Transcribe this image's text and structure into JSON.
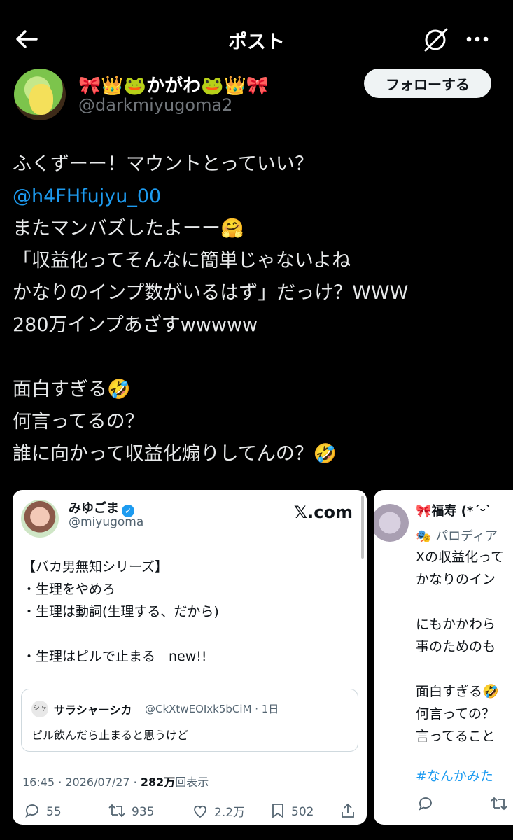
{
  "header": {
    "title": "ポスト"
  },
  "author": {
    "display_name": "🎀👑🐸かがわ🐸👑🎀",
    "handle": "@darkmiyugoma2",
    "follow_label": "フォローする"
  },
  "post": {
    "lines": [
      "ふくずーー！マウントとっていい？",
      "@h4FHfujyu_00",
      "またマンバズしたよーー🤗",
      "「収益化ってそんなに簡単じゃないよね",
      "かなりのインプ数がいるはず」だっけ？WWW",
      "280万インプあざすwwwww",
      "",
      "面白すぎる🤣",
      "何言ってるの？",
      "誰に向かって収益化煽りしてんの？🤣"
    ]
  },
  "card1": {
    "name": "みゆごま",
    "handle": "@miyugoma",
    "source": "𝕏.com",
    "lines": [
      "【バカ男無知シリーズ】",
      "・生理をやめろ",
      "・生理は動詞(生理する、だから)",
      "",
      "・生理はピルで止まる　new!!"
    ],
    "quote": {
      "avatar_text": "シャ",
      "name": "サラシャーシカ",
      "handle": "@CkXtwEOIxk5bCiM · 1日",
      "text": "ピル飲んだら止まると思うけど"
    },
    "meta_time": "16:45 · 2026/07/27 · ",
    "meta_views": "282万",
    "meta_views_suffix": "回表示",
    "actions": {
      "replies": "55",
      "reposts": "935",
      "likes": "2.2万",
      "bookmarks": "502"
    }
  },
  "card2": {
    "name": "🎀福寿 (*´ᵕ`",
    "label": "🎭 パロディア",
    "lines": [
      "Xの収益化って",
      "かなりのイン",
      "",
      "にもかかわら",
      "事のためのも",
      "",
      "面白すぎる🤣",
      "何言っての？",
      "言ってること"
    ],
    "hashtag": "#なんかみた"
  }
}
